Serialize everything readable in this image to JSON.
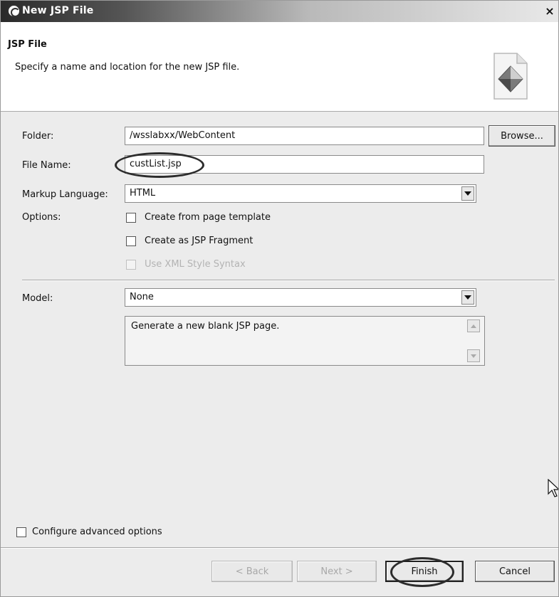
{
  "window": {
    "title": "New JSP File",
    "close_label": "×"
  },
  "header": {
    "title": "JSP File",
    "description": "Specify a name and location for the new JSP file."
  },
  "form": {
    "folder_label": "Folder:",
    "folder_value": "/wsslabxx/WebContent",
    "browse_label": "Browse...",
    "filename_label": "File Name:",
    "filename_value": "custList.jsp",
    "markup_label": "Markup Language:",
    "markup_value": "HTML",
    "options_label": "Options:",
    "options": [
      {
        "label": "Create from page template",
        "checked": false,
        "enabled": true
      },
      {
        "label": "Create as JSP Fragment",
        "checked": false,
        "enabled": true
      },
      {
        "label": "Use XML Style Syntax",
        "checked": false,
        "enabled": false
      }
    ],
    "model_label": "Model:",
    "model_value": "None",
    "model_description": "Generate a new blank JSP page.",
    "advanced_label": "Configure advanced options"
  },
  "buttons": {
    "back": "< Back",
    "next": "Next >",
    "finish": "Finish",
    "cancel": "Cancel"
  },
  "icons": [
    "wizard-swirl-icon",
    "close-icon",
    "jsp-file-wizard-icon",
    "dropdown-arrow-icon",
    "scroll-up-icon",
    "scroll-down-icon",
    "mouse-pointer-icon"
  ]
}
